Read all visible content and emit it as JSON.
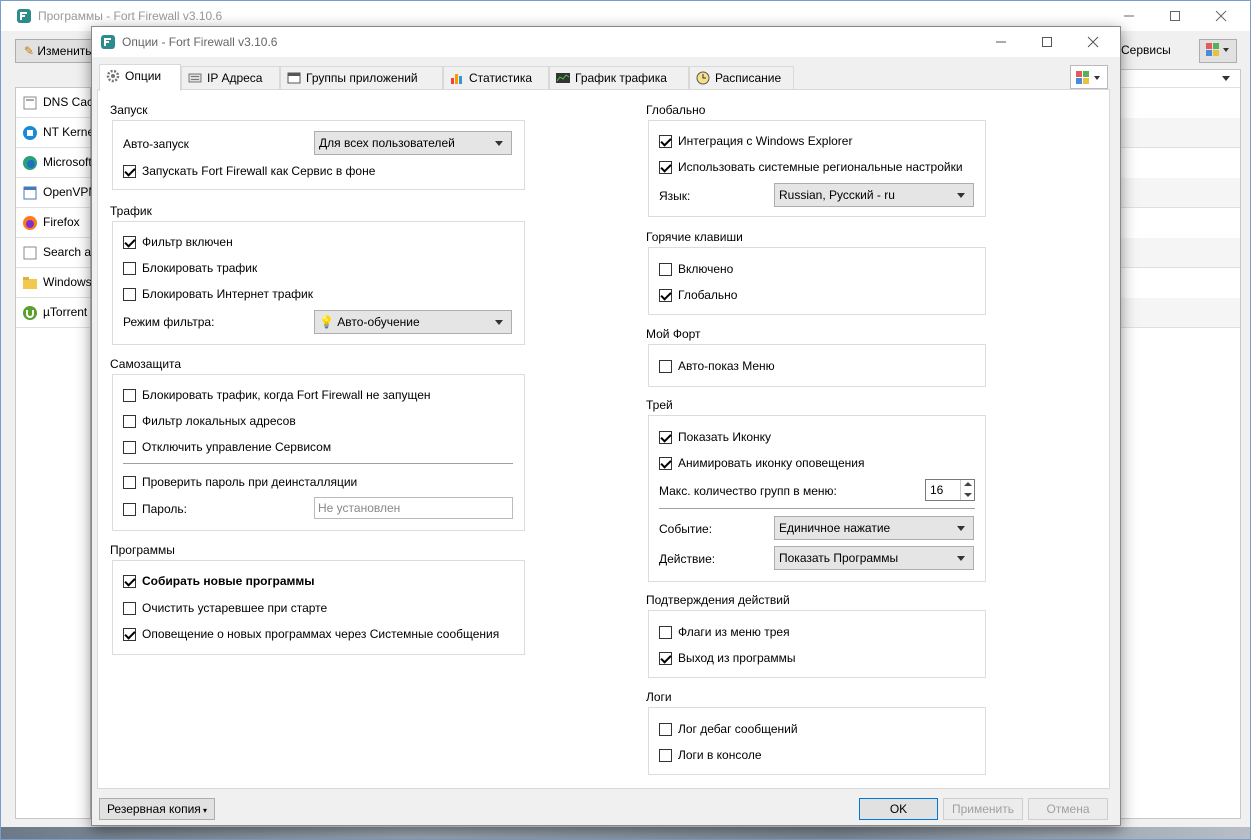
{
  "main_window": {
    "title": "Программы - Fort Firewall v3.10.6",
    "edit_button": "Изменить",
    "services_button": "Сервисы",
    "programs": [
      {
        "name": "DNS Cach",
        "icon": "gear-icon"
      },
      {
        "name": "NT Kerne",
        "icon": "windows-icon"
      },
      {
        "name": "Microsoft",
        "icon": "edge-icon"
      },
      {
        "name": "OpenVPN",
        "icon": "app-icon"
      },
      {
        "name": "Firefox",
        "icon": "firefox-icon"
      },
      {
        "name": "Search ap",
        "icon": "app-icon"
      },
      {
        "name": "Windows",
        "icon": "folder-icon"
      },
      {
        "name": "µTorrent",
        "icon": "utorrent-icon"
      }
    ]
  },
  "dialog": {
    "title": "Опции - Fort Firewall v3.10.6",
    "tabs": [
      {
        "label": "Опции",
        "icon": "gear-icon"
      },
      {
        "label": "IP Адреса",
        "icon": "network-icon"
      },
      {
        "label": "Группы приложений",
        "icon": "folder-icon"
      },
      {
        "label": "Статистика",
        "icon": "bar-chart-icon"
      },
      {
        "label": "График трафика",
        "icon": "graph-icon"
      },
      {
        "label": "Расписание",
        "icon": "clock-icon"
      }
    ],
    "startup": {
      "title": "Запуск",
      "autorun_label": "Авто-запуск",
      "autorun_value": "Для всех пользователей",
      "service_label": "Запускать Fort Firewall как Сервис в фоне"
    },
    "traffic": {
      "title": "Трафик",
      "filter_enabled": "Фильтр включен",
      "block_traffic": "Блокировать трафик",
      "block_internet": "Блокировать Интернет трафик",
      "filter_mode_label": "Режим фильтра:",
      "filter_mode_value": "Авто-обучение"
    },
    "protection": {
      "title": "Самозащита",
      "block_not_running": "Блокировать трафик, когда Fort Firewall не запущен",
      "filter_local": "Фильтр локальных адресов",
      "disable_service_control": "Отключить управление Сервисом",
      "check_password": "Проверить пароль при деинсталляции",
      "password_label": "Пароль:",
      "password_placeholder": "Не установлен"
    },
    "programs": {
      "title": "Программы",
      "collect_new": "Собирать новые программы",
      "purge_on_start": "Очистить устаревшее при старте",
      "notify_new": "Оповещение о новых программах через Системные сообщения"
    },
    "global": {
      "title": "Глобально",
      "explorer_integration": "Интеграция с Windows Explorer",
      "use_system_locale": "Использовать системные региональные настройки",
      "language_label": "Язык:",
      "language_value": "Russian, Русский - ru"
    },
    "hotkeys": {
      "title": "Горячие клавиши",
      "enabled": "Включено",
      "global": "Глобально"
    },
    "myfort": {
      "title": "Мой Форт",
      "auto_show_menu": "Авто-показ Меню"
    },
    "tray": {
      "title": "Трей",
      "show_icon": "Показать Иконку",
      "animate_alert": "Анимировать иконку оповещения",
      "max_groups_label": "Макс. количество групп в меню:",
      "max_groups_value": "16",
      "event_label": "Событие:",
      "event_value": "Единичное нажатие",
      "action_label": "Действие:",
      "action_value": "Показать Программы"
    },
    "confirmations": {
      "title": "Подтверждения действий",
      "tray_flags": "Флаги из меню трея",
      "exit_program": "Выход из программы"
    },
    "logs": {
      "title": "Логи",
      "debug_log": "Лог дебаг сообщений",
      "console_log": "Логи в консоле"
    },
    "footer": {
      "backup": "Резервная копия",
      "ok": "OK",
      "apply": "Применить",
      "cancel": "Отмена"
    }
  },
  "colors": {
    "accent": "#0078d7",
    "app_icon": "#2e8b8b"
  }
}
